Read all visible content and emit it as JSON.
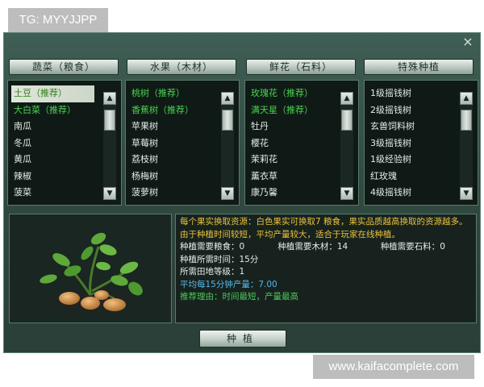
{
  "watermarks": {
    "top": "TG: MYYJJPP",
    "bottom": "www.kaifacomplete.com"
  },
  "window": {
    "close_glyph": "×",
    "close_icon": "close-icon"
  },
  "categories": [
    {
      "tab_label": "蔬菜（粮食）",
      "items": [
        {
          "label": "土豆（推荐）",
          "style": "selected"
        },
        {
          "label": "大白菜（推荐）",
          "style": "green"
        },
        {
          "label": "南瓜",
          "style": "normal"
        },
        {
          "label": "冬瓜",
          "style": "normal"
        },
        {
          "label": "黄瓜",
          "style": "normal"
        },
        {
          "label": "辣椒",
          "style": "normal"
        },
        {
          "label": "菠菜",
          "style": "normal"
        }
      ]
    },
    {
      "tab_label": "水果（木材）",
      "items": [
        {
          "label": "桃树（推荐）",
          "style": "green"
        },
        {
          "label": "香蕉树（推荐）",
          "style": "green"
        },
        {
          "label": "苹果树",
          "style": "normal"
        },
        {
          "label": "草莓树",
          "style": "normal"
        },
        {
          "label": "荔枝树",
          "style": "normal"
        },
        {
          "label": "杨梅树",
          "style": "normal"
        },
        {
          "label": "菠萝树",
          "style": "normal"
        }
      ]
    },
    {
      "tab_label": "鲜花（石料）",
      "items": [
        {
          "label": "玫瑰花（推荐）",
          "style": "green"
        },
        {
          "label": "满天星（推荐）",
          "style": "green"
        },
        {
          "label": "牡丹",
          "style": "normal"
        },
        {
          "label": "樱花",
          "style": "normal"
        },
        {
          "label": "茉莉花",
          "style": "normal"
        },
        {
          "label": "薰衣草",
          "style": "normal"
        },
        {
          "label": "康乃馨",
          "style": "normal"
        }
      ]
    },
    {
      "tab_label": "特殊种植",
      "items": [
        {
          "label": "1级摇钱树",
          "style": "normal"
        },
        {
          "label": "2级摇钱树",
          "style": "normal"
        },
        {
          "label": "玄兽饲料树",
          "style": "normal"
        },
        {
          "label": "3级摇钱树",
          "style": "normal"
        },
        {
          "label": "1级经验树",
          "style": "normal"
        },
        {
          "label": "红玫瑰",
          "style": "normal"
        },
        {
          "label": "4级摇钱树",
          "style": "normal"
        }
      ]
    }
  ],
  "scrollbar": {
    "up_glyph": "▲",
    "down_glyph": "▼"
  },
  "info": {
    "description": "每个果实换取资源：白色果实可换取7 粮食，果实品质越高换取的资源越多。由于种植时间较短，平均产量较大，适合于玩家在线种植。",
    "need_food_label": "种植需要粮食：",
    "need_food_value": "0",
    "need_wood_label": "种植需要木材：",
    "need_wood_value": "14",
    "need_stone_label": "种植需要石料：",
    "need_stone_value": "0",
    "time_line": "种植所需时间：15分",
    "field_level_line": "所需田地等级：1",
    "yield_line": "平均每15分钟产量：7.00",
    "reason_line": "推荐理由：时间最短，产量最高"
  },
  "preview": {
    "icon": "potato-plant-icon"
  },
  "actions": {
    "plant_label": "种植"
  },
  "colors": {
    "recommended_green": "#4bd44f",
    "description_yellow": "#e9c23a",
    "yield_blue": "#56b8ea",
    "panel_bg": "#0f1a16",
    "window_bg": "#3f5e55"
  }
}
